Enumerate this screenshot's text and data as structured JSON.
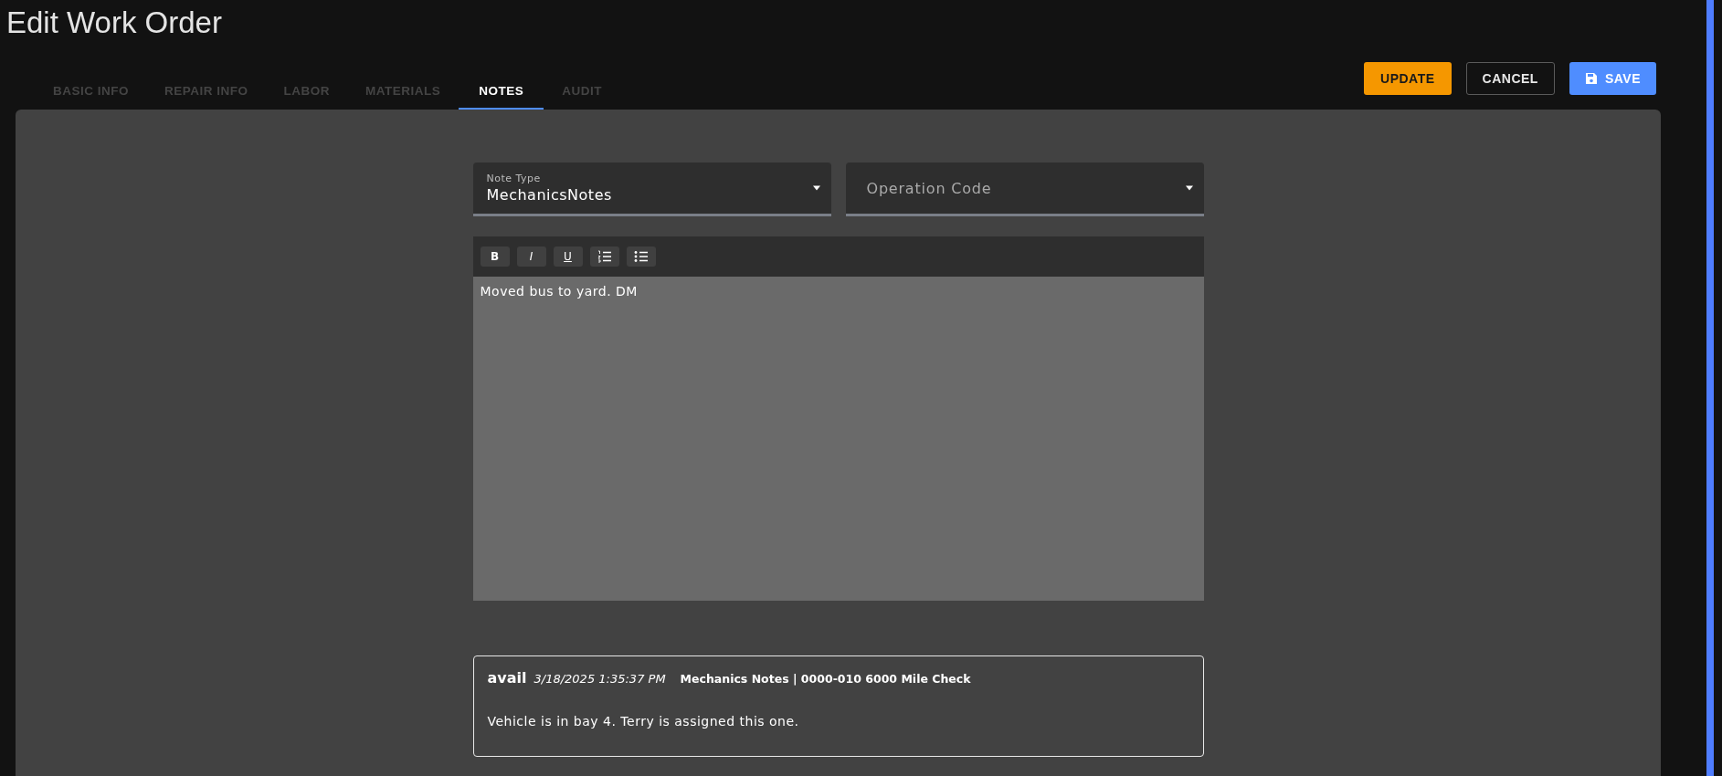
{
  "title": "Edit Work Order",
  "tabs": [
    {
      "label": "BASIC INFO",
      "selected": false
    },
    {
      "label": "REPAIR INFO",
      "selected": false
    },
    {
      "label": "LABOR",
      "selected": false
    },
    {
      "label": "MATERIALS",
      "selected": false
    },
    {
      "label": "NOTES",
      "selected": true
    },
    {
      "label": "AUDIT",
      "selected": false
    }
  ],
  "actions": [
    {
      "kind": "update",
      "label": "UPDATE"
    },
    {
      "kind": "cancel",
      "label": "CANCEL"
    },
    {
      "kind": "save",
      "label": "SAVE"
    }
  ],
  "note_type": {
    "label": "Note Type",
    "value": "MechanicsNotes"
  },
  "operation_code": {
    "placeholder": "Operation Code"
  },
  "editor": {
    "toolbar": [
      {
        "kind": "bold",
        "label": "B"
      },
      {
        "kind": "italic",
        "label": "I"
      },
      {
        "kind": "underline",
        "label": "U"
      },
      {
        "kind": "ordered-list"
      },
      {
        "kind": "bullet-list"
      }
    ],
    "value": "Moved bus to yard. DM"
  },
  "notes": [
    {
      "author": "avail",
      "timestamp": "3/18/2025 1:35:37 PM",
      "category": "Mechanics Notes | 0000-010 6000 Mile Check",
      "body": "Vehicle is in bay 4. Terry is assigned this one."
    }
  ]
}
